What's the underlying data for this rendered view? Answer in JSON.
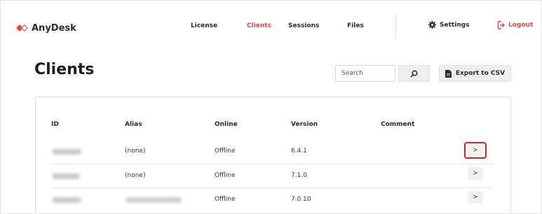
{
  "header": {
    "brand": "AnyDesk",
    "nav": [
      {
        "label": "License",
        "active": false
      },
      {
        "label": "Clients",
        "active": true
      },
      {
        "label": "Sessions",
        "active": false
      },
      {
        "label": "Files",
        "active": false
      }
    ],
    "settings_label": "Settings",
    "logout_label": "Logout"
  },
  "page": {
    "title": "Clients",
    "search_placeholder": "Search",
    "export_label": "Export to CSV"
  },
  "table": {
    "columns": [
      "ID",
      "Alias",
      "Online",
      "Version",
      "Comment"
    ],
    "rows": [
      {
        "alias": "(none)",
        "online": "Offline",
        "version": "6.4.1",
        "comment": ""
      },
      {
        "alias": "(none)",
        "online": "Offline",
        "version": "7.1.0",
        "comment": ""
      },
      {
        "alias": "",
        "online": "Offline",
        "version": "7.0.10",
        "comment": ""
      }
    ],
    "open_label": ">"
  },
  "colors": {
    "accent": "#ef443b",
    "highlight": "#e0201a",
    "button_bg": "#eeeeee"
  }
}
